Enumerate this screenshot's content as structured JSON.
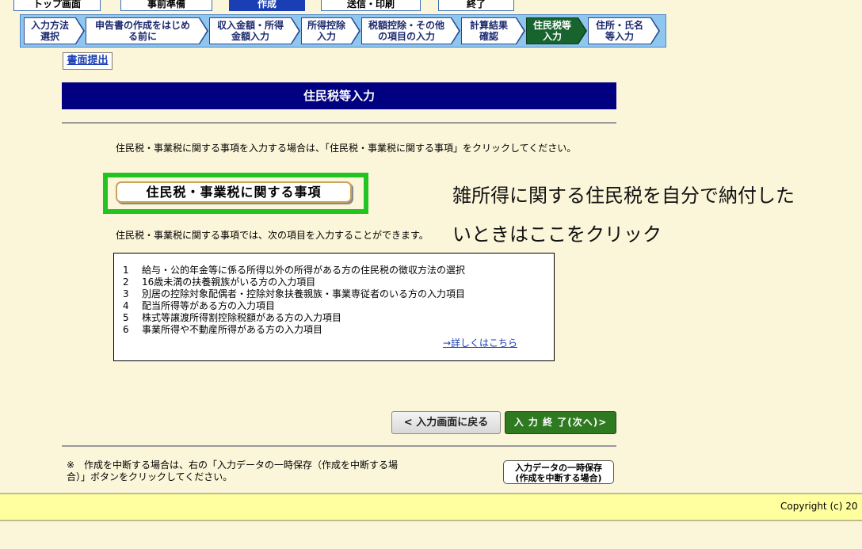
{
  "top_tabs": [
    {
      "label": "トップ画面"
    },
    {
      "label": "事前準備"
    },
    {
      "label": "作成"
    },
    {
      "label": "送信・印刷"
    },
    {
      "label": "終了"
    }
  ],
  "steps": [
    {
      "line1": "入力方法",
      "line2": "選択"
    },
    {
      "line1": "申告書の作成をはじめ",
      "line2": "る前に"
    },
    {
      "line1": "収入金額・所得",
      "line2": "金額入力"
    },
    {
      "line1": "所得控除",
      "line2": "入力"
    },
    {
      "line1": "税額控除・その他",
      "line2": "の項目の入力"
    },
    {
      "line1": "計算結果",
      "line2": "確認"
    },
    {
      "line1": "住民税等",
      "line2": "入力"
    },
    {
      "line1": "住所・氏名",
      "line2": "等入力"
    }
  ],
  "document_submit_label": "書面提出",
  "page_title": "住民税等入力",
  "intro_text": "住民税・事業税に関する事項を入力する場合は、「住民税・事業税に関する事項」をクリックしてください。",
  "resident_tax_button": "住民税・事業税に関する事項",
  "annotation": {
    "line1": "雑所得に関する住民税を自分で納付した",
    "line2": "いときはここをクリック"
  },
  "items_intro": "住民税・事業税に関する事項では、次の項目を入力することができます。",
  "items": [
    {
      "num": "1",
      "text": "給与・公的年金等に係る所得以外の所得がある方の住民税の徴収方法の選択"
    },
    {
      "num": "2",
      "text": "16歳未満の扶養親族がいる方の入力項目"
    },
    {
      "num": "3",
      "text": "別居の控除対象配偶者・控除対象扶養親族・事業専従者のいる方の入力項目"
    },
    {
      "num": "4",
      "text": "配当所得等がある方の入力項目"
    },
    {
      "num": "5",
      "text": "株式等譲渡所得割控除税額がある方の入力項目"
    },
    {
      "num": "6",
      "text": "事業所得や不動産所得がある方の入力項目"
    }
  ],
  "detail_link": "→詳しくはこちら",
  "back_button": "< 入力画面に戻る",
  "next_button": "入 力 終 了(次へ)>",
  "note_text": "※　作成を中断する場合は、右の「入力データの一時保存（作成を中断する場合）」ボタンをクリックしてください。",
  "save_button": {
    "line1": "入力データの一時保存",
    "line2": "(作成を中断する場合)"
  },
  "copyright": "Copyright (c) 20",
  "colors": {
    "background": "#fbf5d9",
    "title_bar": "#010080",
    "current_step": "#17642e",
    "highlight_frame": "#22c421",
    "next_button": "#2f7a20"
  }
}
